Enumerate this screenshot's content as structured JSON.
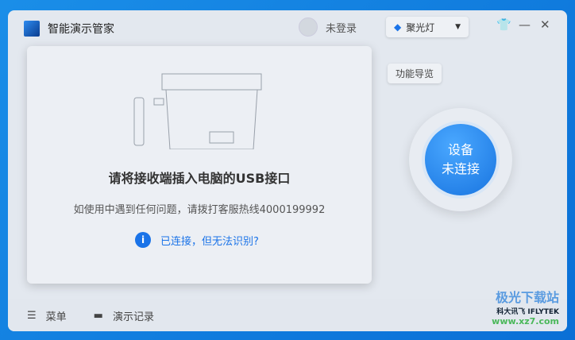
{
  "app": {
    "title": "智能演示管家"
  },
  "header": {
    "login": "未登录",
    "mode": "聚光灯"
  },
  "card": {
    "heading": "请将接收端插入电脑的USB接口",
    "hotline": "如使用中遇到任何问题，请拨打客服热线4000199992",
    "help_link": "已连接，但无法识别?"
  },
  "side": {
    "guide": "功能导览",
    "status_line1": "设备",
    "status_line2": "未连接"
  },
  "footer": {
    "menu": "菜单",
    "records": "演示记录"
  },
  "watermark": {
    "site": "极光下载站",
    "brand": "科大讯飞 IFLYTEK",
    "url": "www.xz7.com"
  }
}
